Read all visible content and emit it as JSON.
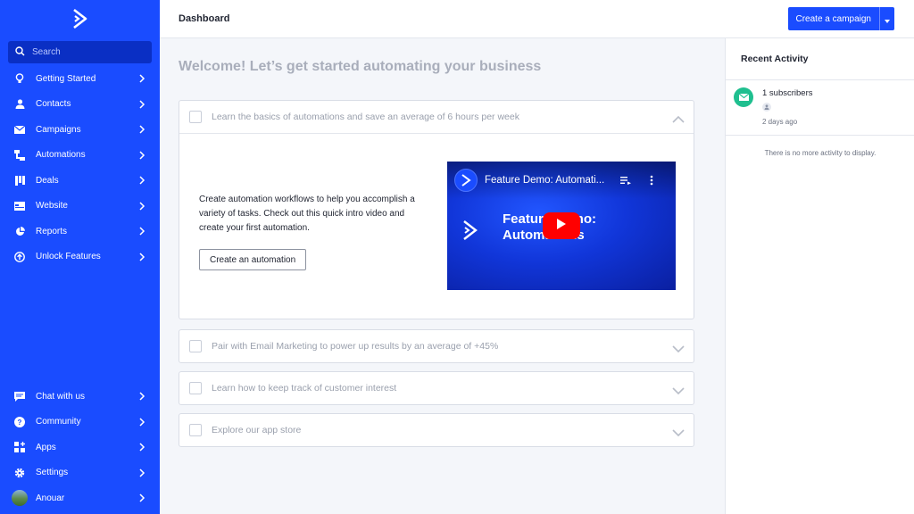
{
  "sidebar": {
    "search_placeholder": "Search",
    "items": [
      {
        "label": "Getting Started",
        "icon": "lightbulb-icon"
      },
      {
        "label": "Contacts",
        "icon": "person-icon"
      },
      {
        "label": "Campaigns",
        "icon": "envelope-icon"
      },
      {
        "label": "Automations",
        "icon": "workflow-icon"
      },
      {
        "label": "Deals",
        "icon": "pipeline-icon"
      },
      {
        "label": "Website",
        "icon": "browser-icon"
      },
      {
        "label": "Reports",
        "icon": "pie-chart-icon"
      },
      {
        "label": "Unlock Features",
        "icon": "upgrade-arrow-icon"
      }
    ],
    "bottom_items": [
      {
        "label": "Chat with us",
        "icon": "chat-icon"
      },
      {
        "label": "Community",
        "icon": "help-icon"
      },
      {
        "label": "Apps",
        "icon": "apps-grid-icon"
      },
      {
        "label": "Settings",
        "icon": "gear-icon"
      },
      {
        "label": "Anouar",
        "icon": "user-avatar"
      }
    ]
  },
  "header": {
    "title": "Dashboard",
    "cta_label": "Create a campaign"
  },
  "main": {
    "welcome": "Welcome! Let’s get started automating your business",
    "panels": [
      {
        "title": "Learn the basics of automations and save an average of 6 hours per week",
        "expanded": true
      },
      {
        "title": "Pair with Email Marketing to power up results by an average of +45%",
        "expanded": false
      },
      {
        "title": "Learn how to keep track of customer interest",
        "expanded": false
      },
      {
        "title": "Explore our app store",
        "expanded": false
      }
    ],
    "body_text": "Create automation workflows to help you accomplish a variety of tasks. Check out this quick intro video and create your first automation.",
    "create_button": "Create an automation",
    "video": {
      "title": "Feature Demo: Automati...",
      "big_text_line1": "Feature Demo:",
      "big_text_line2": "Automations"
    }
  },
  "activity": {
    "title": "Recent Activity",
    "item_text": "1 subscribers",
    "item_time": "2 days ago",
    "empty_text": "There is no more activity to display."
  },
  "colors": {
    "brand": "#1a4cff",
    "sidebar_dark": "#0a2fc4",
    "activity_green": "#1fbf8f",
    "play_red": "#ff0000"
  }
}
